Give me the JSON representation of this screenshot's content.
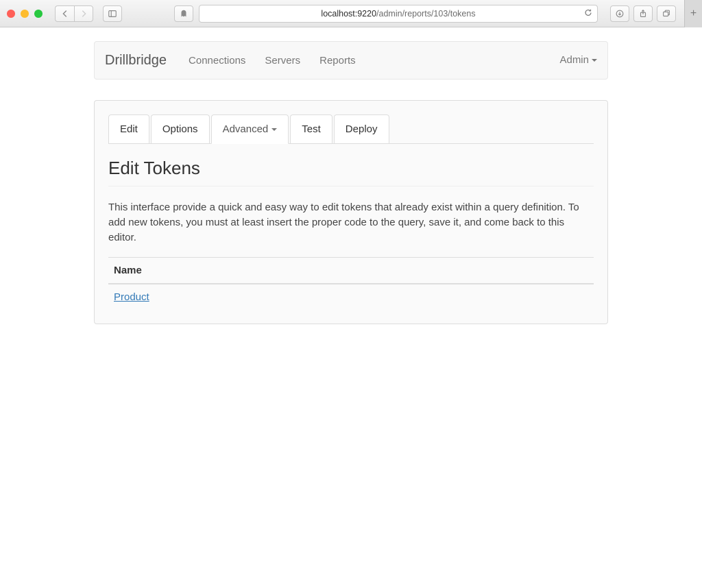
{
  "browser": {
    "url_host": "localhost:9220",
    "url_path": "/admin/reports/103/tokens"
  },
  "navbar": {
    "brand": "Drillbridge",
    "items": [
      "Connections",
      "Servers",
      "Reports"
    ],
    "right_label": "Admin"
  },
  "tabs": {
    "items": [
      {
        "label": "Edit",
        "active": false,
        "dropdown": false
      },
      {
        "label": "Options",
        "active": false,
        "dropdown": false
      },
      {
        "label": "Advanced",
        "active": true,
        "dropdown": true
      },
      {
        "label": "Test",
        "active": false,
        "dropdown": false
      },
      {
        "label": "Deploy",
        "active": false,
        "dropdown": false
      }
    ]
  },
  "section": {
    "title": "Edit Tokens",
    "lead": "This interface provide a quick and easy way to edit tokens that already exist within a query definition. To add new tokens, you must at least insert the proper code to the query, save it, and come back to this editor."
  },
  "table": {
    "header": "Name",
    "rows": [
      {
        "name": "Product"
      }
    ]
  }
}
